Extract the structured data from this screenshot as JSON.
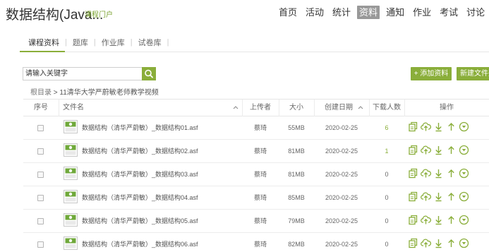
{
  "header": {
    "course_title": "数据结构(Java...",
    "portal_link": "课程门户",
    "nav": [
      {
        "label": "首页",
        "active": false
      },
      {
        "label": "活动",
        "active": false
      },
      {
        "label": "统计",
        "active": false
      },
      {
        "label": "资料",
        "active": true
      },
      {
        "label": "通知",
        "active": false
      },
      {
        "label": "作业",
        "active": false
      },
      {
        "label": "考试",
        "active": false
      },
      {
        "label": "讨论",
        "active": false
      }
    ]
  },
  "subtabs": [
    "课程资料",
    "题库",
    "作业库",
    "试卷库"
  ],
  "search": {
    "placeholder": "请输入关键字"
  },
  "buttons": {
    "add": "+ 添加资料",
    "new": "新建文件夹"
  },
  "breadcrumb": {
    "root": "根目录",
    "sep": ">",
    "current": "11清华大学严蔚敏老师教学视频"
  },
  "table": {
    "headers": {
      "index": "序号",
      "filename": "文件名",
      "uploader": "上传者",
      "size": "大小",
      "created": "创建日期",
      "downloads": "下载人数",
      "actions": "操作"
    },
    "rows": [
      {
        "name": "数据结构（清华严蔚敏）_数据结构01.asf",
        "uploader": "蔡琦",
        "size": "55MB",
        "date": "2020-02-25",
        "downloads": "6"
      },
      {
        "name": "数据结构（清华严蔚敏）_数据结构02.asf",
        "uploader": "蔡琦",
        "size": "81MB",
        "date": "2020-02-25",
        "downloads": "1"
      },
      {
        "name": "数据结构（清华严蔚敏）_数据结构03.asf",
        "uploader": "蔡琦",
        "size": "81MB",
        "date": "2020-02-25",
        "downloads": "0"
      },
      {
        "name": "数据结构（清华严蔚敏）_数据结构04.asf",
        "uploader": "蔡琦",
        "size": "85MB",
        "date": "2020-02-25",
        "downloads": "0"
      },
      {
        "name": "数据结构（清华严蔚敏）_数据结构05.asf",
        "uploader": "蔡琦",
        "size": "79MB",
        "date": "2020-02-25",
        "downloads": "0"
      },
      {
        "name": "数据结构（清华严蔚敏）_数据结构06.asf",
        "uploader": "蔡琦",
        "size": "82MB",
        "date": "2020-02-25",
        "downloads": "0"
      }
    ]
  },
  "colors": {
    "accent": "#8aae3a",
    "nav_active_bg": "#999999"
  },
  "icons": [
    "search-icon",
    "video-file-icon",
    "copy-icon",
    "upload-cloud-icon",
    "download-icon",
    "move-up-icon",
    "more-circle-icon",
    "sort-caret-icon"
  ]
}
